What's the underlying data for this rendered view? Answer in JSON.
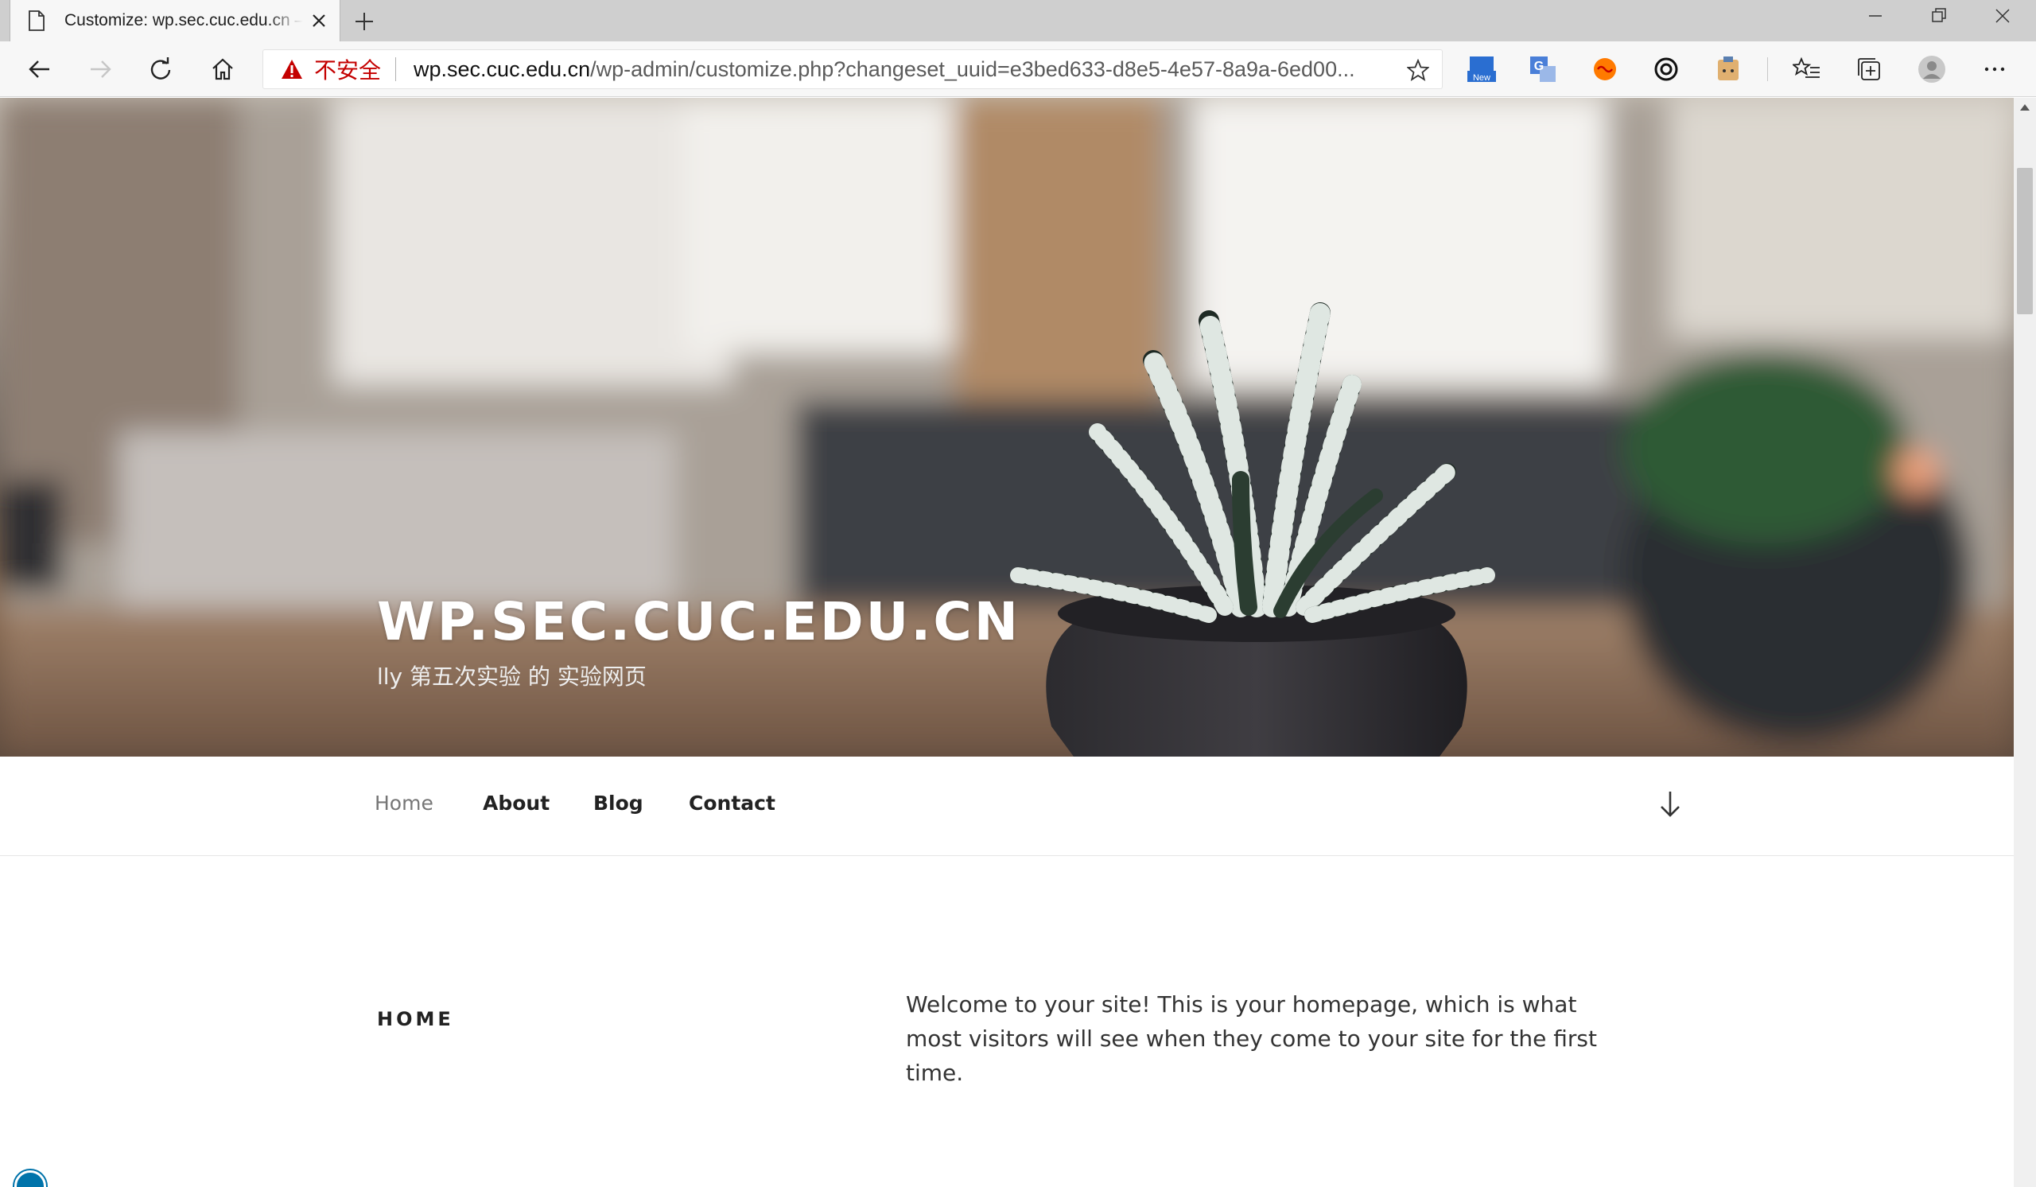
{
  "browser": {
    "tab": {
      "title": "Customize: wp.sec.cuc.edu.cn – lly",
      "page_icon": "page-icon",
      "close_icon": "close-icon"
    },
    "new_tab_icon": "plus-icon",
    "window_controls": [
      "minimize-icon",
      "restore-icon",
      "close-icon"
    ],
    "toolbar": {
      "back_icon": "back-arrow-icon",
      "forward_icon": "forward-arrow-icon",
      "refresh_icon": "refresh-icon",
      "home_icon": "home-icon",
      "security_warning": "不安全",
      "url_host": "wp.sec.cuc.edu.cn",
      "url_path": "/wp-admin/customize.php?changeset_uuid=e3bed633-d8e5-4e57-8a9a-6ed00...",
      "favorite_icon": "star-icon",
      "extensions": [
        {
          "name": "new-extension-icon",
          "badge": "New"
        },
        {
          "name": "translate-extension-icon",
          "badge": "G"
        },
        {
          "name": "orange-extension-icon"
        },
        {
          "name": "link-extension-icon"
        },
        {
          "name": "clipboard-extension-icon"
        }
      ],
      "favorites_icon": "favorites-list-icon",
      "collections_icon": "collections-icon",
      "profile_icon": "profile-avatar-icon",
      "more_icon": "more-dots-icon"
    }
  },
  "site": {
    "title": "WP.SEC.CUC.EDU.CN",
    "description": "lly 第五次实验 的 实验网页",
    "nav": {
      "items": [
        {
          "label": "Home",
          "current": true
        },
        {
          "label": "About",
          "current": false
        },
        {
          "label": "Blog",
          "current": false
        },
        {
          "label": "Contact",
          "current": false
        }
      ],
      "scroll_icon": "arrow-down-icon"
    },
    "page": {
      "heading": "HOME",
      "body": "Welcome to your site! This is your homepage, which is what most visitors will see when they come to your site for the first time."
    }
  },
  "colors": {
    "insecure_text": "#c40000",
    "accent": "#0073aa"
  }
}
